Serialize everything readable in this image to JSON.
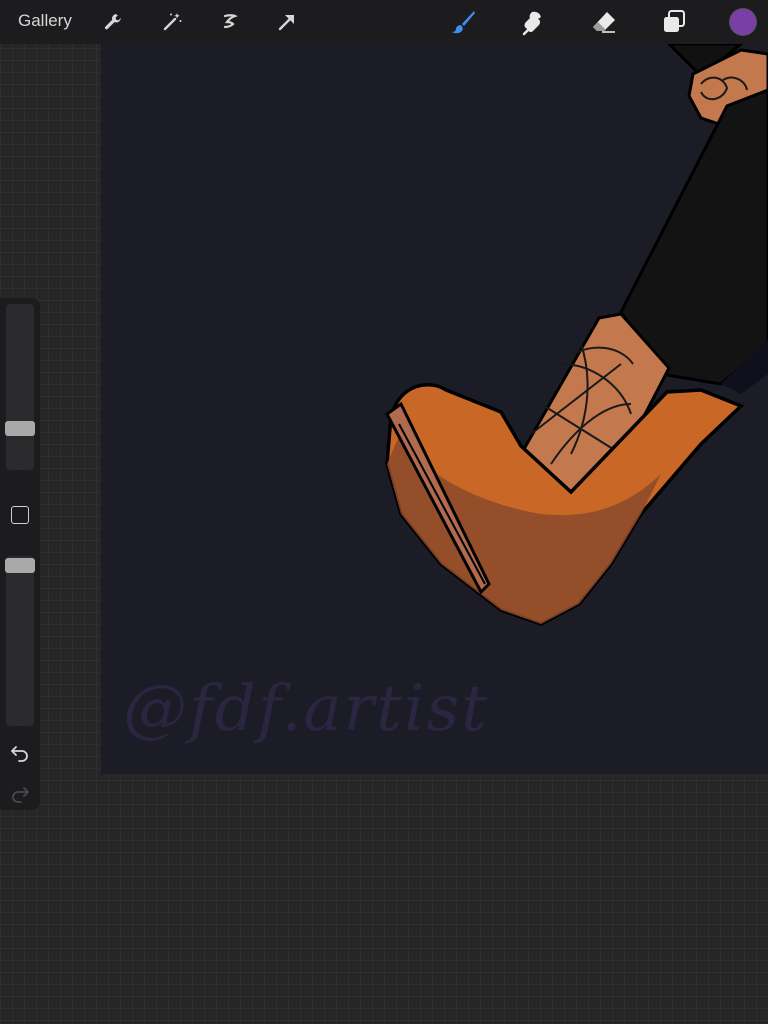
{
  "toolbar": {
    "gallery_label": "Gallery",
    "left_tools": [
      "wrench-icon",
      "magic-wand-icon",
      "selection-icon",
      "transform-arrow-icon"
    ],
    "right_tools": [
      "brush-icon",
      "smudge-icon",
      "eraser-icon",
      "layers-icon"
    ],
    "active_tool": "brush",
    "active_color": "#7a3fa6",
    "accent": "#3e8ff0"
  },
  "sidebar": {
    "brush_size_level": 0.12,
    "opacity_level": 1.0,
    "controls": [
      "modify-square-icon",
      "undo-icon",
      "redo-icon"
    ]
  },
  "canvas": {
    "background": "#1b1c25",
    "watermark": "@fdf.artist"
  }
}
